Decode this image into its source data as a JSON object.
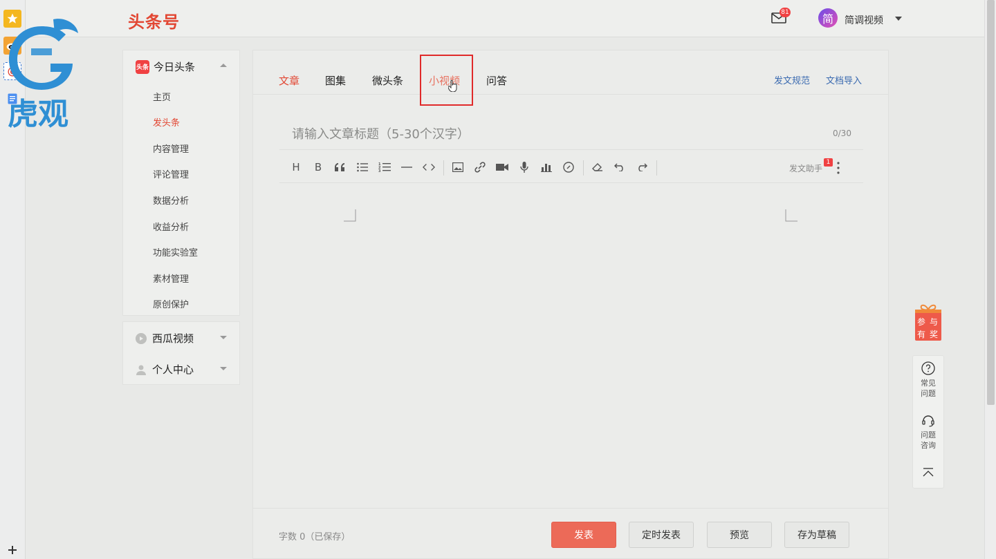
{
  "brand": {
    "title": "头条号",
    "logo_text": "虎观"
  },
  "header": {
    "mail_badge": "81",
    "user_avatar_char": "简",
    "user_name": "简调视频"
  },
  "sidebar": {
    "main_group": {
      "icon_text": "头条",
      "label": "今日头条",
      "items": [
        {
          "label": "主页"
        },
        {
          "label": "发头条"
        },
        {
          "label": "内容管理"
        },
        {
          "label": "评论管理"
        },
        {
          "label": "数据分析"
        },
        {
          "label": "收益分析"
        },
        {
          "label": "功能实验室"
        },
        {
          "label": "素材管理"
        },
        {
          "label": "原创保护"
        }
      ],
      "active_item": "发头条"
    },
    "other_groups": [
      {
        "label": "西瓜视频"
      },
      {
        "label": "个人中心"
      }
    ]
  },
  "tabs": {
    "items": [
      {
        "label": "文章"
      },
      {
        "label": "图集"
      },
      {
        "label": "微头条"
      },
      {
        "label": "小视频"
      },
      {
        "label": "问答"
      }
    ],
    "active": "文章",
    "highlighted": "小视频",
    "links": [
      {
        "label": "发文规范"
      },
      {
        "label": "文档导入"
      }
    ]
  },
  "editor": {
    "title_placeholder": "请输入文章标题（5-30个汉字）",
    "title_count": "0/30",
    "toolbar": {
      "heading_glyph": "H",
      "bold_glyph": "B",
      "assistant_label": "发文助手",
      "assistant_badge": "1"
    }
  },
  "footer": {
    "word_count": "字数 0（已保存）",
    "buttons": {
      "publish": "发表",
      "schedule": "定时发表",
      "preview": "预览",
      "save_draft": "存为草稿"
    }
  },
  "floating": {
    "gift_text": "参与有奖",
    "faq": "常见问题",
    "consult": "问题咨询"
  },
  "colors": {
    "accent": "#e24733",
    "primary_button": "#ec6a58",
    "link": "#3a6ab0",
    "highlight_box": "#e02a2a"
  }
}
